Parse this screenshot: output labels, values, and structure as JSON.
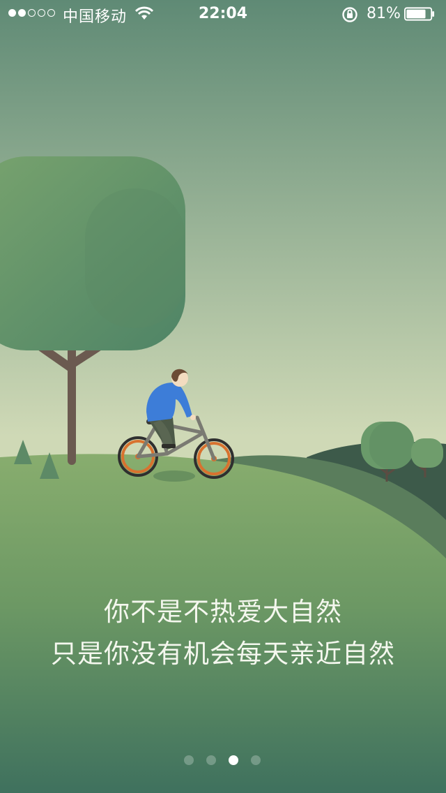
{
  "status_bar": {
    "signal": [
      true,
      true,
      false,
      false,
      false
    ],
    "carrier": "中国移动",
    "time": "22:04",
    "battery_percent": "81%",
    "battery_level": 0.81,
    "wifi_icon": "wifi-icon",
    "lock_icon": "rotation-lock-icon"
  },
  "onboarding": {
    "caption_line_1": "你不是不热爱大自然",
    "caption_line_2": "只是你没有机会每天亲近自然"
  },
  "pager": {
    "total": 4,
    "active_index": 2
  },
  "colors": {
    "sky_top": "#5f8a75",
    "sky_bottom": "#cfd9b6",
    "hill": "#7fa86a",
    "bike_wheel": "#d8722f",
    "rider_shirt": "#3d7dd8"
  }
}
